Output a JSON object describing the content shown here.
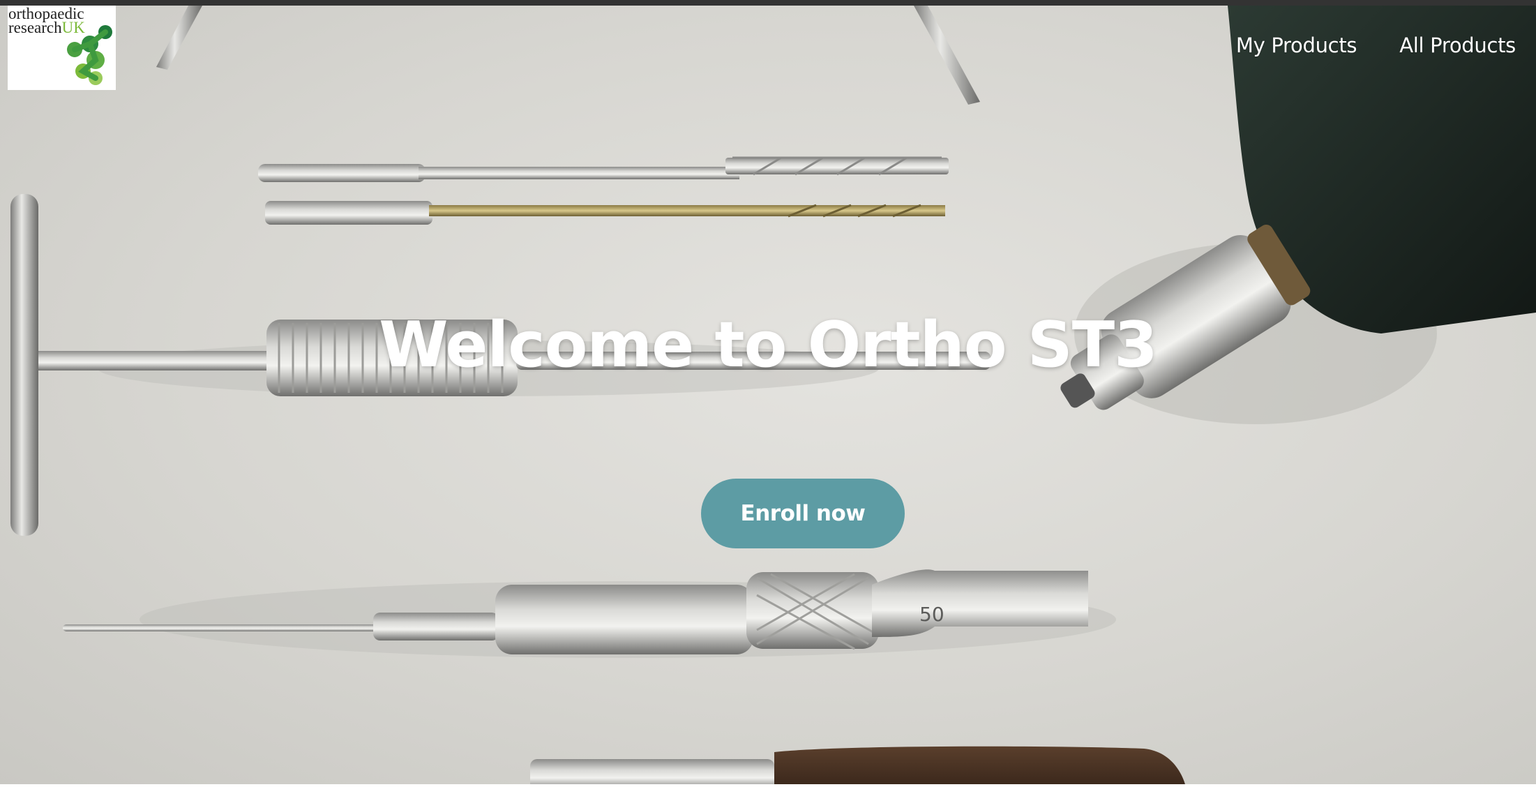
{
  "brand": {
    "logo_line1": "orthopaedic",
    "logo_line2": "research",
    "logo_uk": "UK"
  },
  "nav": {
    "items": [
      {
        "label": "My Products"
      },
      {
        "label": "All Products"
      }
    ]
  },
  "hero": {
    "title": "Welcome to Ortho ST3",
    "cta_label": "Enroll now"
  },
  "colors": {
    "top_bar": "#333333",
    "cta_background": "#5d9ca4",
    "cta_text": "#ffffff",
    "nav_text": "#ffffff",
    "logo_green": "#7cba3a"
  }
}
